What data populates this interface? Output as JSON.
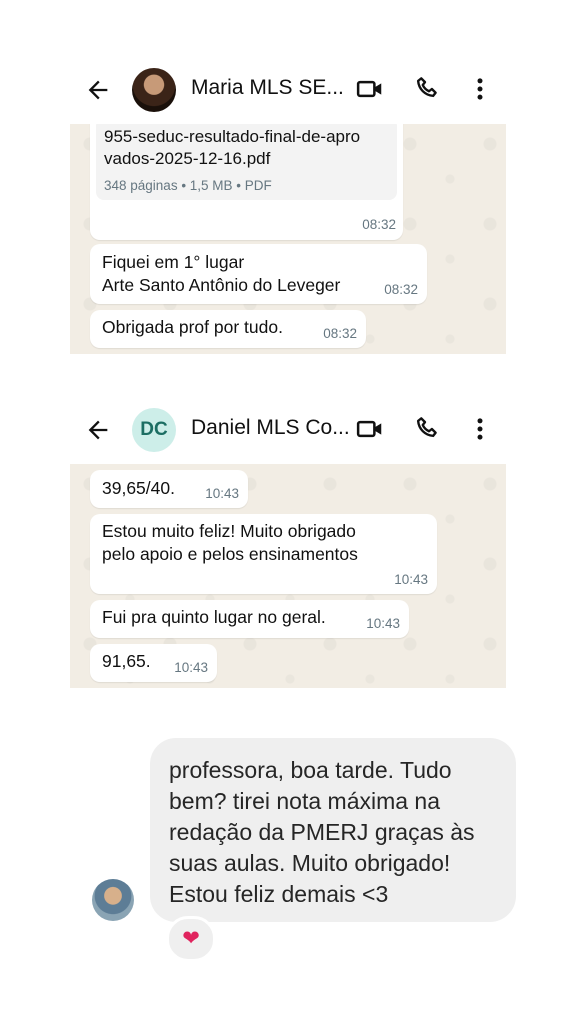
{
  "chat1": {
    "contact_name": "Maria MLS SE...",
    "document": {
      "name_line1": "955-seduc-resultado-final-de-apro",
      "name_line2": "vados-2025-12-16.pdf",
      "meta": "348 páginas • 1,5 MB • PDF",
      "time": "08:32"
    },
    "messages": [
      {
        "line1": "Fiquei em 1° lugar",
        "line2": "Arte Santo Antônio do Leveger",
        "time": "08:32"
      },
      {
        "text": "Obrigada prof por tudo.",
        "time": "08:32"
      }
    ]
  },
  "chat2": {
    "contact_name": "Daniel MLS Co...",
    "avatar_initials": "DC",
    "messages": [
      {
        "text": "39,65/40.",
        "time": "10:43"
      },
      {
        "line1": "Estou muito feliz! Muito obrigado",
        "line2": "pelo apoio e pelos ensinamentos",
        "time": "10:43"
      },
      {
        "text": "Fui pra quinto lugar no geral.",
        "time": "10:43"
      },
      {
        "text": "91,65.",
        "time": "10:43"
      }
    ]
  },
  "dm": {
    "message": "professora, boa tarde. Tudo bem? tirei nota máxima na redação da PMERJ graças às suas aulas. Muito obrigado! Estou feliz demais <3",
    "reaction": "❤"
  },
  "icons": [
    "back-arrow-icon",
    "video-call-icon",
    "phone-icon",
    "more-vert-icon",
    "heart-icon"
  ],
  "colors": {
    "chat_bg": "#f2ede4",
    "bubble": "#ffffff",
    "timestamp": "#667781",
    "dm_bubble": "#efefef",
    "avatar_dc": "#cdeee9"
  }
}
